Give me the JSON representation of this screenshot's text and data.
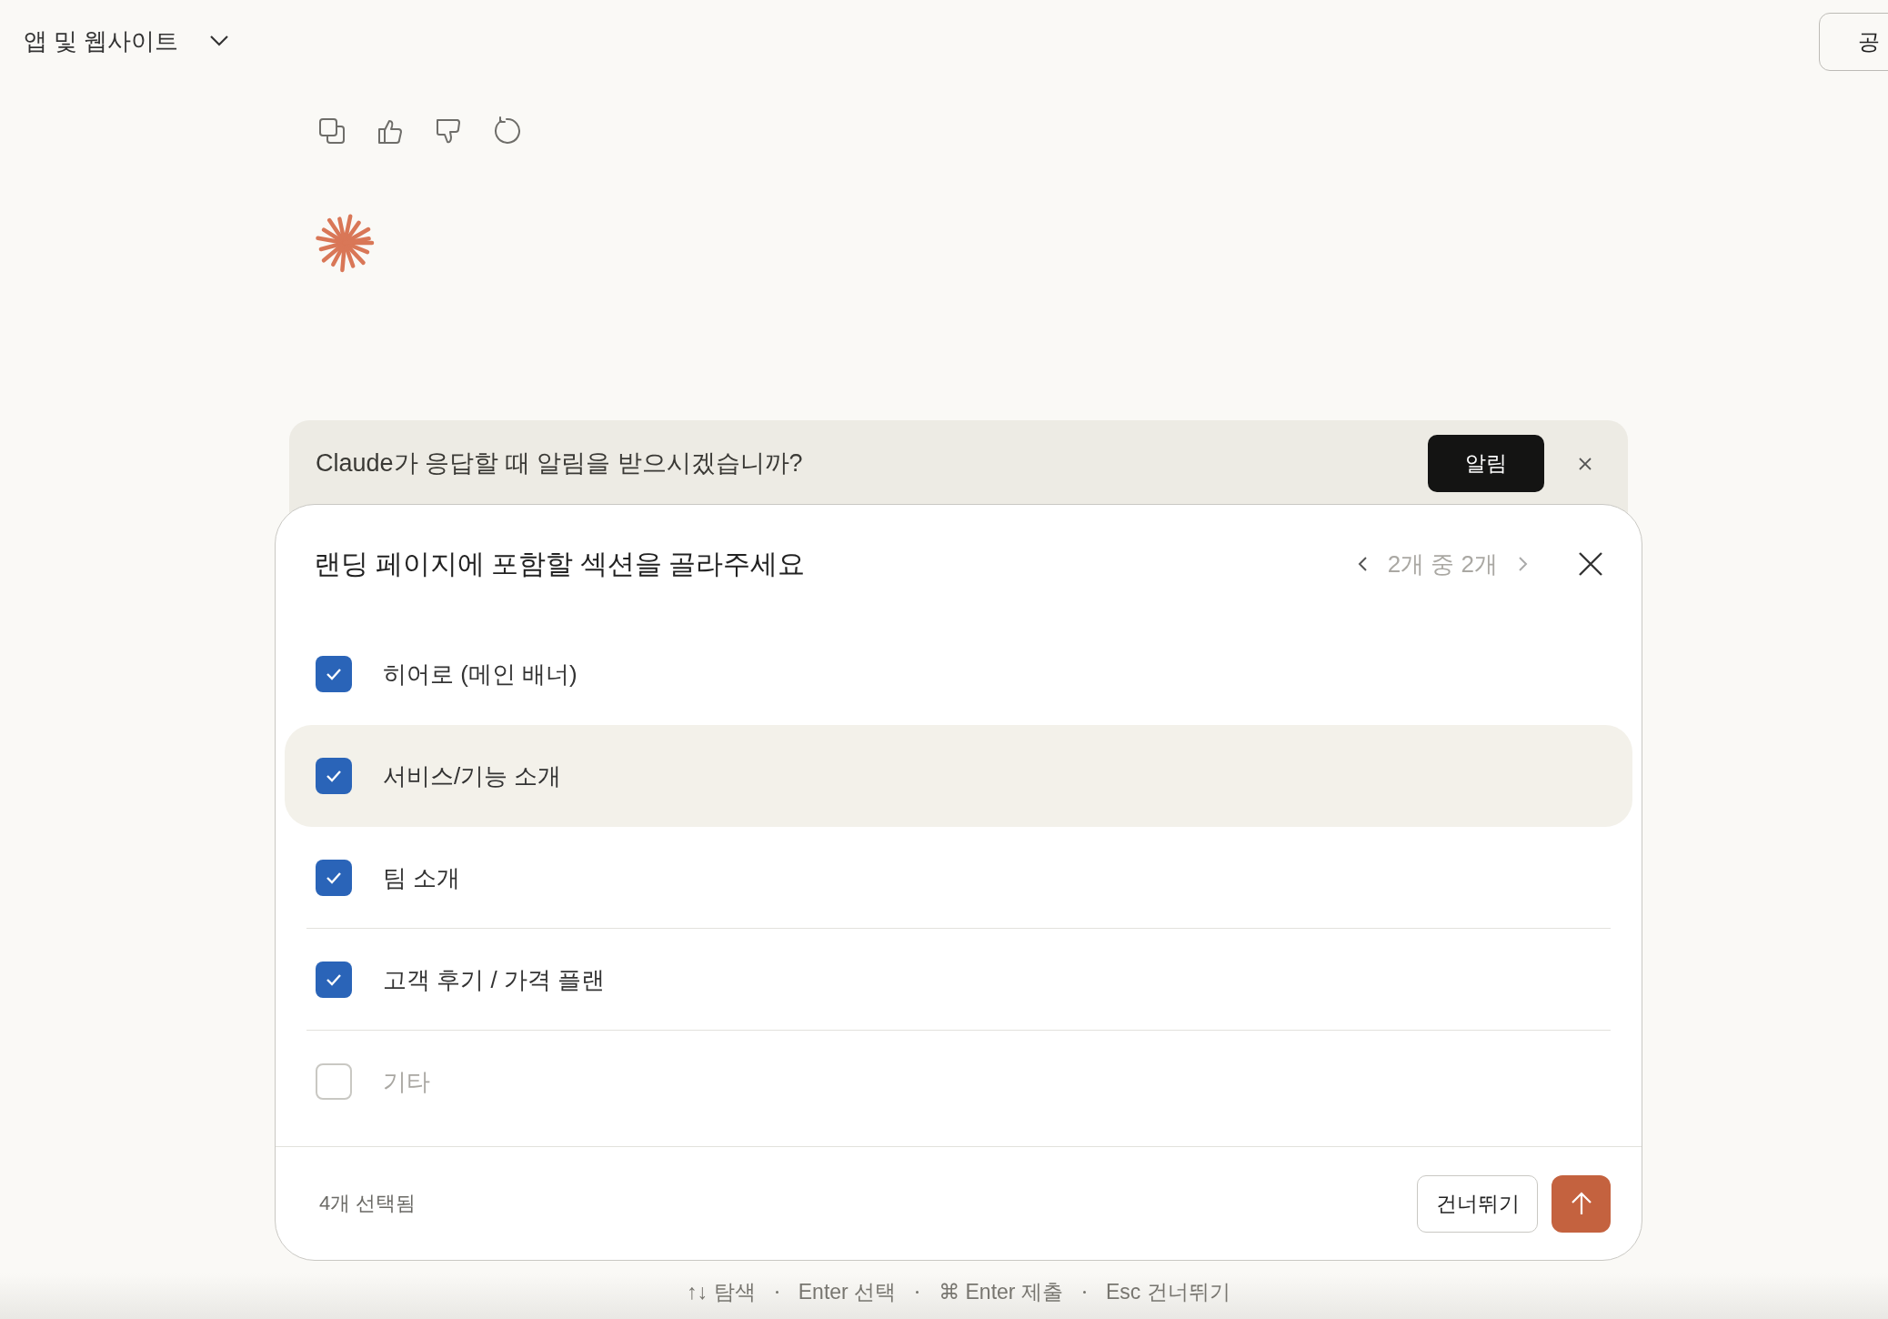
{
  "header": {
    "title": "앱 및 웹사이트",
    "share_button": "공"
  },
  "message_actions": [
    {
      "kind": "copy"
    },
    {
      "kind": "thumbs-up"
    },
    {
      "kind": "thumbs-down"
    },
    {
      "kind": "retry"
    }
  ],
  "notification": {
    "text": "Claude가 응답할 때 알림을 받으시겠습니까?",
    "button": "알림"
  },
  "dialog": {
    "title": "랜딩 페이지에 포함할 섹션을 골라주세요",
    "pager": "2개 중 2개",
    "options": [
      {
        "label": "히어로 (메인 배너)",
        "checked": true,
        "focused": false
      },
      {
        "label": "서비스/기능 소개",
        "checked": true,
        "focused": true
      },
      {
        "label": "팀 소개",
        "checked": true,
        "focused": false
      },
      {
        "label": "고객 후기 / 가격 플랜",
        "checked": true,
        "focused": false
      },
      {
        "label": "기타",
        "checked": false,
        "focused": false
      }
    ],
    "selection_count": "4개 선택됨",
    "skip_button": "건너뛰기"
  },
  "shortcut_hints": [
    "↑↓ 탐색",
    "Enter 선택",
    "⌘ Enter 제출",
    "Esc 건너뛰기"
  ]
}
